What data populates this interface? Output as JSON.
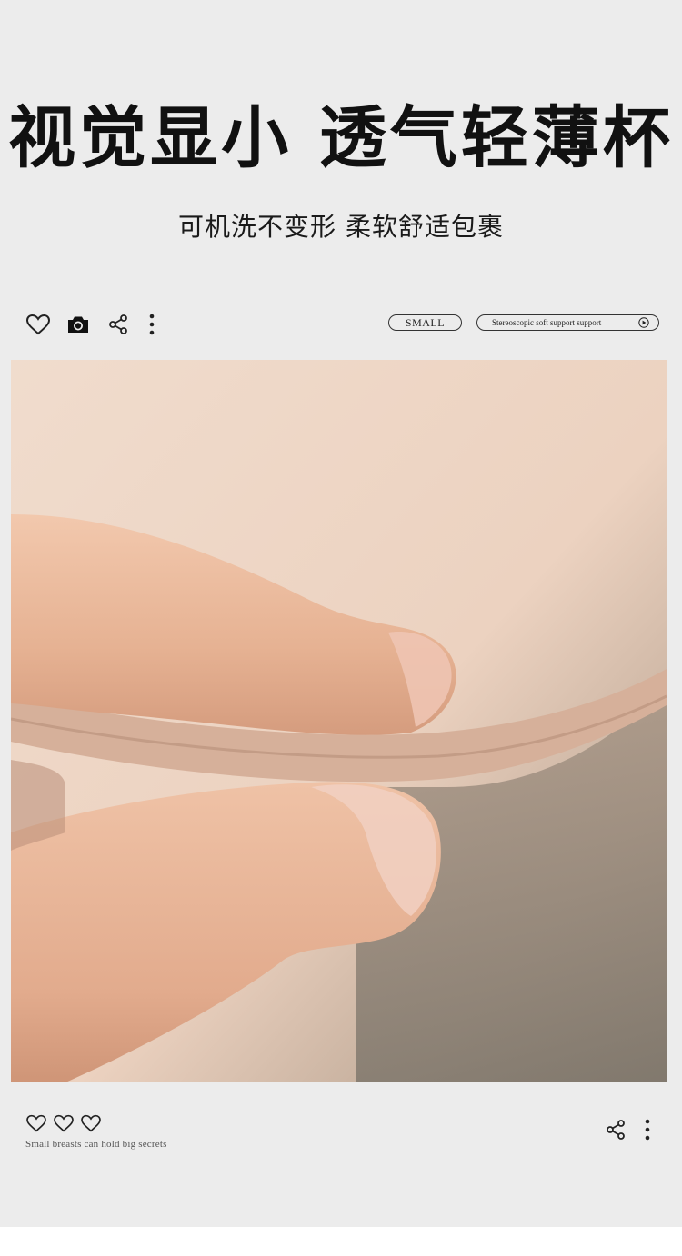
{
  "headline": "视觉显小 透气轻薄杯",
  "subline": "可机洗不变形 柔软舒适包裹",
  "top_toolbar": {
    "icons": [
      "heart-icon",
      "camera-icon",
      "share-icon",
      "more-vertical-icon"
    ],
    "pill_small_label": "SMALL",
    "pill_search_label": "Stereoscopic soft support support"
  },
  "bottom_toolbar": {
    "hearts": [
      "heart-icon",
      "heart-icon",
      "heart-icon"
    ],
    "caption": "Small breasts can hold big secrets",
    "icons": [
      "share-icon",
      "more-vertical-icon"
    ]
  },
  "colors": {
    "page_background": "#ececec",
    "text": "#111111",
    "photo_skin": "#e9c2a6",
    "photo_fabric": "#efd8c8"
  }
}
